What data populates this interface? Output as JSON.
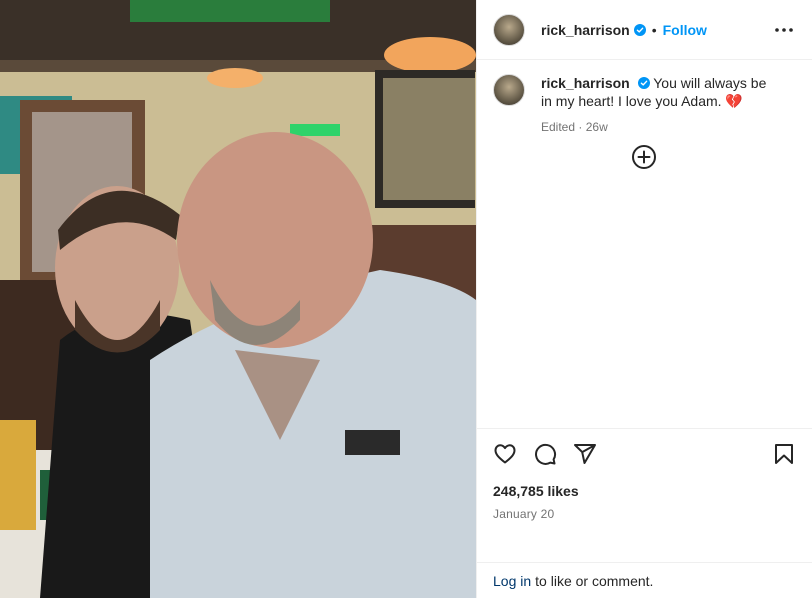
{
  "post": {
    "username": "rick_harrison",
    "follow_label": "Follow",
    "separator": "•",
    "caption": "You will always be in my heart! I love you Adam. 💔",
    "edited_label": "Edited",
    "time_ago": "26w",
    "meta_separator": "·",
    "likes": "248,785 likes",
    "date": "January 20"
  },
  "login": {
    "link_label": "Log in",
    "rest_label": "to like or comment."
  },
  "icons": {
    "verified": "verified-badge-icon",
    "more": "more-options-icon",
    "load_more": "plus-circle-icon",
    "like": "heart-icon",
    "comment": "comment-icon",
    "share": "share-icon",
    "save": "bookmark-icon"
  },
  "colors": {
    "accent": "#0095f6",
    "link": "#00376b",
    "muted": "#737373",
    "text": "#262626",
    "border": "#efefef"
  }
}
